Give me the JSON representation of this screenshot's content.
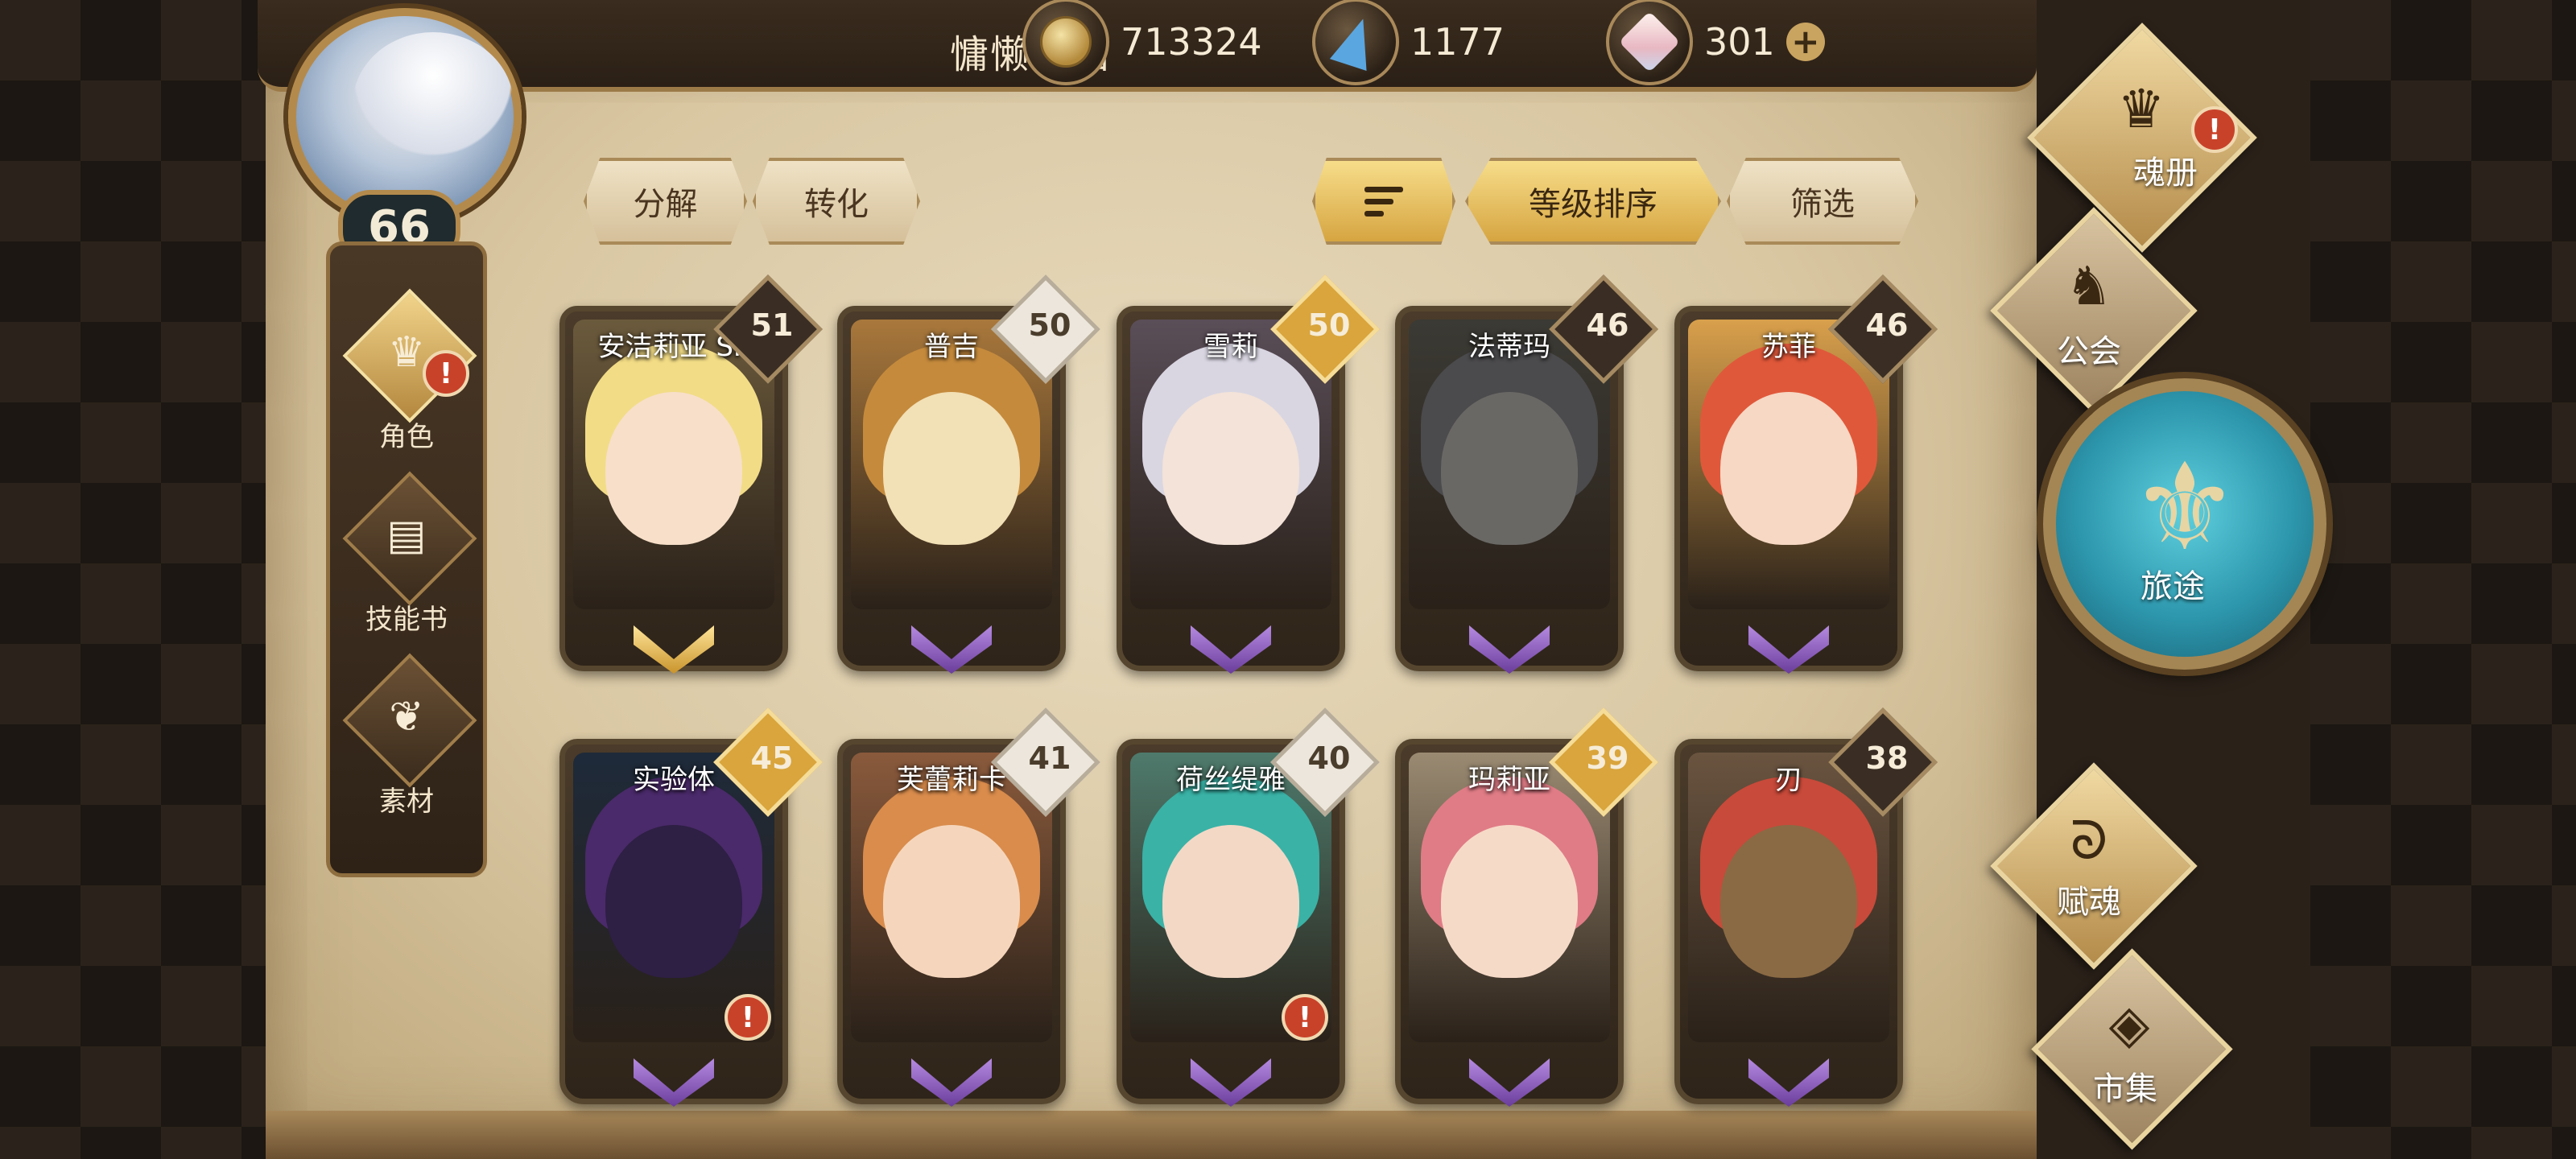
{
  "player": {
    "name": "慵懒的猫",
    "level": "66"
  },
  "resources": {
    "gold": "713324",
    "gem": "1177",
    "crystal": "301",
    "add_symbol": "+"
  },
  "toolbar": {
    "decompose": "分解",
    "transform": "转化",
    "sort_level": "等级排序",
    "filter": "筛选"
  },
  "leftnav": [
    {
      "label": "角色",
      "icon": "helmet-icon",
      "alert": "!"
    },
    {
      "label": "技能书",
      "icon": "book-icon"
    },
    {
      "label": "素材",
      "icon": "material-icon"
    }
  ],
  "cards": [
    {
      "name": "安洁莉亚 SP",
      "level": "51",
      "badge": "dark",
      "rank": "gold",
      "hair": "#f2dc86",
      "face": "#f7dfc9",
      "bg": "#6b5a3c",
      "alert": false
    },
    {
      "name": "普吉",
      "level": "50",
      "badge": "silver",
      "rank": "purple",
      "hair": "#c58a3c",
      "face": "#f2e0b6",
      "bg": "#a9783c",
      "alert": false
    },
    {
      "name": "雪莉",
      "level": "50",
      "badge": "gold",
      "rank": "purple",
      "hair": "#d9d6e2",
      "face": "#f3e3d8",
      "bg": "#5a4e58",
      "alert": false
    },
    {
      "name": "法蒂玛",
      "level": "46",
      "badge": "dark",
      "rank": "purple",
      "hair": "#4b4a4c",
      "face": "#6a6865",
      "bg": "#3b3a34",
      "alert": false
    },
    {
      "name": "苏菲",
      "level": "46",
      "badge": "dark",
      "rank": "purple",
      "hair": "#e0583a",
      "face": "#f6d8c4",
      "bg": "#d9a04c",
      "alert": false
    },
    {
      "name": "实验体",
      "level": "45",
      "badge": "gold",
      "rank": "purple",
      "hair": "#4a2a6a",
      "face": "#2e1f44",
      "bg": "#1e2a3a",
      "alert": true
    },
    {
      "name": "芙蕾莉卡",
      "level": "41",
      "badge": "silver",
      "rank": "purple",
      "hair": "#d98c4c",
      "face": "#f5d6bc",
      "bg": "#8a5a3c",
      "alert": false
    },
    {
      "name": "荷丝缇雅",
      "level": "40",
      "badge": "silver",
      "rank": "purple",
      "hair": "#3ab2a6",
      "face": "#f3d8c6",
      "bg": "#4e7a6c",
      "alert": true
    },
    {
      "name": "玛莉亚",
      "level": "39",
      "badge": "gold",
      "rank": "purple",
      "hair": "#e07c86",
      "face": "#f6dac8",
      "bg": "#9a8a72",
      "alert": false
    },
    {
      "name": "刃",
      "level": "38",
      "badge": "dark",
      "rank": "purple",
      "hair": "#c84a3a",
      "face": "#8a6a44",
      "bg": "#6a5440",
      "alert": false
    }
  ],
  "rightnav": {
    "soulbook": "魂册",
    "guild": "公会",
    "journey": "旅途",
    "talent": "赋魂",
    "market": "市集",
    "alert": "!"
  }
}
